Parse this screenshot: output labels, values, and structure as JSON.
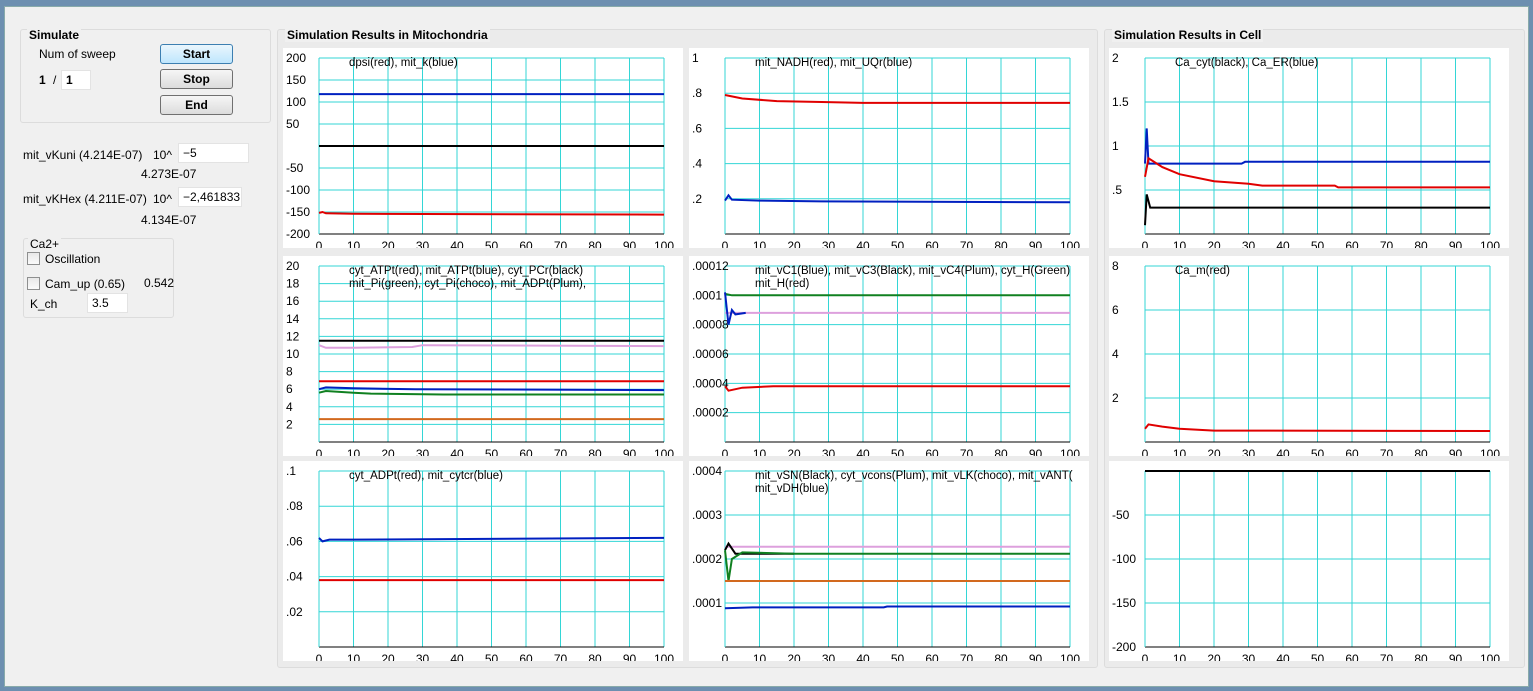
{
  "simulate": {
    "title": "Simulate",
    "num_sweep_label": "Num of sweep",
    "sweep_current": "1",
    "sweep_sep": "/",
    "sweep_total": "1",
    "start": "Start",
    "stop": "Stop",
    "end": "End"
  },
  "params": {
    "vkuni_label": "mit_vKuni (4.214E-07)",
    "vkuni_exp_label": "10^",
    "vkuni_value": "−5",
    "vkuni_result": "4.273E-07",
    "vkhex_label": "mit_vKHex (4.211E-07)",
    "vkhex_exp_label": "10^",
    "vkhex_value": "−2,461833",
    "vkhex_result": "4.134E-07"
  },
  "ca": {
    "title": "Ca2+",
    "oscillation_label": "Oscillation",
    "oscillation_checked": false,
    "camup_label": "Cam_up (0.65)",
    "camup_value": "0.542",
    "camup_checked": false,
    "kch_label": "K_ch",
    "kch_value": "3.5"
  },
  "mito_title": "Simulation Results in Mitochondria",
  "cell_title": "Simulation Results in Cell",
  "colors": {
    "grid": "#33d6d6",
    "red": "#e00000",
    "blue": "#0020c0",
    "black": "#000000",
    "green": "#108020",
    "plum": "#dda0dd",
    "choco": "#d2691e"
  },
  "chart_data": [
    {
      "id": "dpsi",
      "type": "line",
      "legend": [
        "dpsi(red), mit_k(blue)"
      ],
      "xlim": [
        0,
        100
      ],
      "xticks": [
        0,
        10,
        20,
        30,
        40,
        50,
        60,
        70,
        80,
        90,
        100
      ],
      "ylim": [
        -200,
        200
      ],
      "yticks": [
        200,
        150,
        100,
        50,
        -50,
        -100,
        -150,
        -200
      ],
      "ytick_labels": [
        "200",
        "150",
        "100",
        "50",
        "-50",
        "-100",
        "-150",
        "-200"
      ],
      "series": [
        {
          "color": "blue",
          "points": [
            [
              0,
              118
            ],
            [
              100,
              118
            ]
          ]
        },
        {
          "color": "black",
          "points": [
            [
              0,
              0
            ],
            [
              100,
              0
            ]
          ]
        },
        {
          "color": "red",
          "points": [
            [
              0,
              -152
            ],
            [
              1,
              -150
            ],
            [
              2,
              -153
            ],
            [
              10,
              -154
            ],
            [
              100,
              -156
            ]
          ]
        }
      ]
    },
    {
      "id": "nadh",
      "type": "line",
      "legend": [
        "mit_NADH(red), mit_UQr(blue)"
      ],
      "xlim": [
        0,
        100
      ],
      "xticks": [
        0,
        10,
        20,
        30,
        40,
        50,
        60,
        70,
        80,
        90,
        100
      ],
      "ylim": [
        0,
        1
      ],
      "yticks": [
        1,
        0.8,
        0.6,
        0.4,
        0.2
      ],
      "ytick_labels": [
        "1",
        ".8",
        ".6",
        ".4",
        ".2"
      ],
      "series": [
        {
          "color": "red",
          "points": [
            [
              0,
              0.79
            ],
            [
              5,
              0.77
            ],
            [
              15,
              0.755
            ],
            [
              28,
              0.75
            ],
            [
              40,
              0.745
            ],
            [
              100,
              0.745
            ]
          ]
        },
        {
          "color": "blue",
          "points": [
            [
              0,
              0.19
            ],
            [
              1,
              0.22
            ],
            [
              2,
              0.195
            ],
            [
              10,
              0.19
            ],
            [
              28,
              0.185
            ],
            [
              100,
              0.18
            ]
          ]
        }
      ]
    },
    {
      "id": "ca_cyt",
      "type": "line",
      "legend": [
        "Ca_cyt(black), Ca_ER(blue)"
      ],
      "xlim": [
        0,
        100
      ],
      "xticks": [
        0,
        10,
        20,
        30,
        40,
        50,
        60,
        70,
        80,
        90,
        100
      ],
      "ylim": [
        0,
        2
      ],
      "yticks": [
        2,
        1.5,
        1,
        0.5
      ],
      "ytick_labels": [
        "2",
        "1.5",
        "1",
        ".5"
      ],
      "series": [
        {
          "color": "blue",
          "points": [
            [
              0,
              0.8
            ],
            [
              0.5,
              1.2
            ],
            [
              1,
              0.8
            ],
            [
              28,
              0.8
            ],
            [
              29,
              0.82
            ],
            [
              100,
              0.82
            ]
          ]
        },
        {
          "color": "red",
          "points": [
            [
              0,
              0.65
            ],
            [
              1,
              0.86
            ],
            [
              5,
              0.76
            ],
            [
              10,
              0.68
            ],
            [
              20,
              0.6
            ],
            [
              30,
              0.57
            ],
            [
              34,
              0.55
            ],
            [
              55,
              0.55
            ],
            [
              56,
              0.53
            ],
            [
              100,
              0.53
            ]
          ]
        },
        {
          "color": "black",
          "points": [
            [
              0,
              0.1
            ],
            [
              0.5,
              0.45
            ],
            [
              1.5,
              0.3
            ],
            [
              100,
              0.3
            ]
          ]
        }
      ]
    },
    {
      "id": "atp",
      "type": "line",
      "legend": [
        "cyt_ATPt(red), mit_ATPt(blue), cyt_PCr(black)",
        "mit_Pi(green), cyt_Pi(choco), mit_ADPt(Plum),"
      ],
      "xlim": [
        0,
        100
      ],
      "xticks": [
        0,
        10,
        20,
        30,
        40,
        50,
        60,
        70,
        80,
        90,
        100
      ],
      "ylim": [
        0,
        20
      ],
      "yticks": [
        20,
        18,
        16,
        14,
        12,
        10,
        8,
        6,
        4,
        2
      ],
      "ytick_labels": [
        "20",
        "18",
        "16",
        "14",
        "12",
        "10",
        "8",
        "6",
        "4",
        "2"
      ],
      "series": [
        {
          "color": "black",
          "points": [
            [
              0,
              11.5
            ],
            [
              100,
              11.5
            ]
          ]
        },
        {
          "color": "plum",
          "points": [
            [
              0,
              11
            ],
            [
              2,
              10.7
            ],
            [
              10,
              10.7
            ],
            [
              27,
              10.8
            ],
            [
              30,
              11
            ],
            [
              100,
              10.9
            ]
          ]
        },
        {
          "color": "red",
          "points": [
            [
              0,
              6.9
            ],
            [
              100,
              6.9
            ]
          ]
        },
        {
          "color": "blue",
          "points": [
            [
              0,
              6
            ],
            [
              2,
              6.2
            ],
            [
              10,
              6.1
            ],
            [
              28,
              6
            ],
            [
              100,
              5.9
            ]
          ]
        },
        {
          "color": "green",
          "points": [
            [
              0,
              5.6
            ],
            [
              2,
              5.8
            ],
            [
              10,
              5.6
            ],
            [
              15,
              5.5
            ],
            [
              36,
              5.4
            ],
            [
              100,
              5.4
            ]
          ]
        },
        {
          "color": "choco",
          "points": [
            [
              0,
              2.6
            ],
            [
              100,
              2.6
            ]
          ]
        }
      ]
    },
    {
      "id": "vc",
      "type": "line",
      "legend": [
        "mit_vC1(Blue), mit_vC3(Black), mit_vC4(Plum),  cyt_H(Green)",
        "mit_H(red)"
      ],
      "xlim": [
        0,
        100
      ],
      "xticks": [
        0,
        10,
        20,
        30,
        40,
        50,
        60,
        70,
        80,
        90,
        100
      ],
      "ylim": [
        0,
        0.00012
      ],
      "yticks": [
        0.00012,
        0.0001,
        8e-05,
        6e-05,
        4e-05,
        2e-05
      ],
      "ytick_labels": [
        ".00012",
        ".0001",
        ".00008",
        ".00006",
        ".00004",
        ".00002"
      ],
      "series": [
        {
          "color": "green",
          "points": [
            [
              0,
              0.000101
            ],
            [
              2,
              0.0001
            ],
            [
              100,
              0.0001
            ]
          ]
        },
        {
          "color": "plum",
          "points": [
            [
              0,
              8.8e-05
            ],
            [
              100,
              8.8e-05
            ]
          ]
        },
        {
          "color": "blue",
          "points": [
            [
              0,
              0.000102
            ],
            [
              1,
              8e-05
            ],
            [
              2,
              9e-05
            ],
            [
              3,
              8.7e-05
            ],
            [
              6,
              8.8e-05
            ]
          ]
        },
        {
          "color": "red",
          "points": [
            [
              0,
              3.8e-05
            ],
            [
              1,
              3.5e-05
            ],
            [
              5,
              3.7e-05
            ],
            [
              14,
              3.8e-05
            ],
            [
              100,
              3.8e-05
            ]
          ]
        }
      ]
    },
    {
      "id": "ca_m",
      "type": "line",
      "legend": [
        "Ca_m(red)"
      ],
      "xlim": [
        0,
        100
      ],
      "xticks": [
        0,
        10,
        20,
        30,
        40,
        50,
        60,
        70,
        80,
        90,
        100
      ],
      "ylim": [
        0,
        8
      ],
      "yticks": [
        8,
        6,
        4,
        2
      ],
      "ytick_labels": [
        "8",
        "6",
        "4",
        "2"
      ],
      "series": [
        {
          "color": "red",
          "points": [
            [
              0,
              0.6
            ],
            [
              1,
              0.8
            ],
            [
              5,
              0.7
            ],
            [
              10,
              0.6
            ],
            [
              20,
              0.52
            ],
            [
              100,
              0.5
            ]
          ]
        }
      ]
    },
    {
      "id": "adp",
      "type": "line",
      "legend": [
        "cyt_ADPt(red), mit_cytcr(blue)"
      ],
      "xlim": [
        0,
        100
      ],
      "xticks": [
        0,
        10,
        20,
        30,
        40,
        50,
        60,
        70,
        80,
        90,
        100
      ],
      "ylim": [
        0,
        0.1
      ],
      "yticks": [
        0.1,
        0.08,
        0.06,
        0.04,
        0.02
      ],
      "ytick_labels": [
        ".1",
        ".08",
        ".06",
        ".04",
        ".02"
      ],
      "series": [
        {
          "color": "blue",
          "points": [
            [
              0,
              0.062
            ],
            [
              1,
              0.06
            ],
            [
              3,
              0.061
            ],
            [
              10,
              0.061
            ],
            [
              100,
              0.062
            ]
          ]
        },
        {
          "color": "red",
          "points": [
            [
              0,
              0.038
            ],
            [
              100,
              0.038
            ]
          ]
        }
      ]
    },
    {
      "id": "vsn",
      "type": "line",
      "legend": [
        "mit_vSN(Black), cyt_vcons(Plum), mit_vLK(choco), mit_vANT(",
        "mit_vDH(blue)"
      ],
      "xlim": [
        0,
        100
      ],
      "xticks": [
        0,
        10,
        20,
        30,
        40,
        50,
        60,
        70,
        80,
        90,
        100
      ],
      "ylim": [
        0,
        0.0004
      ],
      "yticks": [
        0.0004,
        0.0003,
        0.0002,
        0.0001
      ],
      "ytick_labels": [
        ".0004",
        ".0003",
        ".0002",
        ".0001"
      ],
      "series": [
        {
          "color": "plum",
          "points": [
            [
              0,
              0.000228
            ],
            [
              100,
              0.000228
            ]
          ]
        },
        {
          "color": "black",
          "points": [
            [
              0,
              0.00022
            ],
            [
              1,
              0.000235
            ],
            [
              3,
              0.000212
            ],
            [
              20,
              0.000212
            ]
          ]
        },
        {
          "color": "green",
          "points": [
            [
              0,
              0.00022
            ],
            [
              1,
              0.00015
            ],
            [
              2,
              0.0002
            ],
            [
              5,
              0.000215
            ],
            [
              20,
              0.000212
            ],
            [
              100,
              0.000212
            ]
          ]
        },
        {
          "color": "choco",
          "points": [
            [
              0,
              0.00015
            ],
            [
              100,
              0.00015
            ]
          ]
        },
        {
          "color": "blue",
          "points": [
            [
              0,
              8.8e-05
            ],
            [
              8,
              9e-05
            ],
            [
              46,
              9e-05
            ],
            [
              47,
              9.2e-05
            ],
            [
              100,
              9.2e-05
            ]
          ]
        }
      ]
    },
    {
      "id": "empty",
      "type": "line",
      "legend": [],
      "xlim": [
        0,
        100
      ],
      "xticks": [
        0,
        10,
        20,
        30,
        40,
        50,
        60,
        70,
        80,
        90,
        100
      ],
      "ylim": [
        -200,
        0
      ],
      "yticks": [
        -50,
        -100,
        -150,
        -200
      ],
      "ytick_labels": [
        "-50",
        "-100",
        "-150",
        "-200"
      ],
      "series": [
        {
          "color": "black",
          "points": [
            [
              0,
              0
            ],
            [
              100,
              0
            ]
          ]
        }
      ]
    }
  ]
}
